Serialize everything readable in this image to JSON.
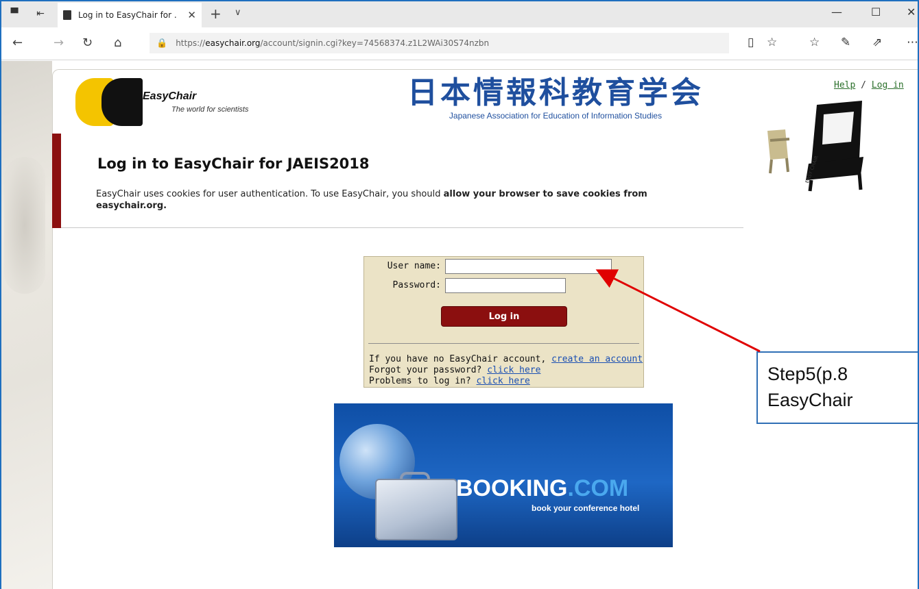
{
  "browser": {
    "tab_title": "Log in to EasyChair for .",
    "url_prefix": "https://",
    "url_domain": "easychair.org",
    "url_path": "/account/signin.cgi?key=74568374.z1L2WAi30S74nzbn"
  },
  "header": {
    "easychair_name": "EasyChair",
    "easychair_tagline": "The world for scientists",
    "jaeis_title_jp": "日本情報科教育学会",
    "jaeis_title_en": "Japanese Association for Education of Information Studies",
    "help_label": "Help",
    "login_label": "Log in",
    "link_separator": "/"
  },
  "main": {
    "title": "Log in to EasyChair for JAEIS2018",
    "cookie_text_plain": "EasyChair uses cookies for user authentication. To use EasyChair, you should ",
    "cookie_text_bold": "allow your browser to save cookies from easychair.org."
  },
  "login": {
    "username_label": "User name:",
    "password_label": "Password:",
    "username_value": "",
    "password_value": "",
    "button_label": "Log in",
    "no_account_text": "If you have no EasyChair account, ",
    "create_account_link": "create an account",
    "forgot_text": "Forgot your password? ",
    "forgot_link": "click here",
    "problems_text": "Problems to log in? ",
    "problems_link": "click here"
  },
  "banner": {
    "brand_main": "BOOKING",
    "brand_suffix": ".COM",
    "tagline": "book your conference hotel"
  },
  "annotation": {
    "line1": "Step5(p.8",
    "line2": "EasyChair",
    "color": "#e00000"
  }
}
